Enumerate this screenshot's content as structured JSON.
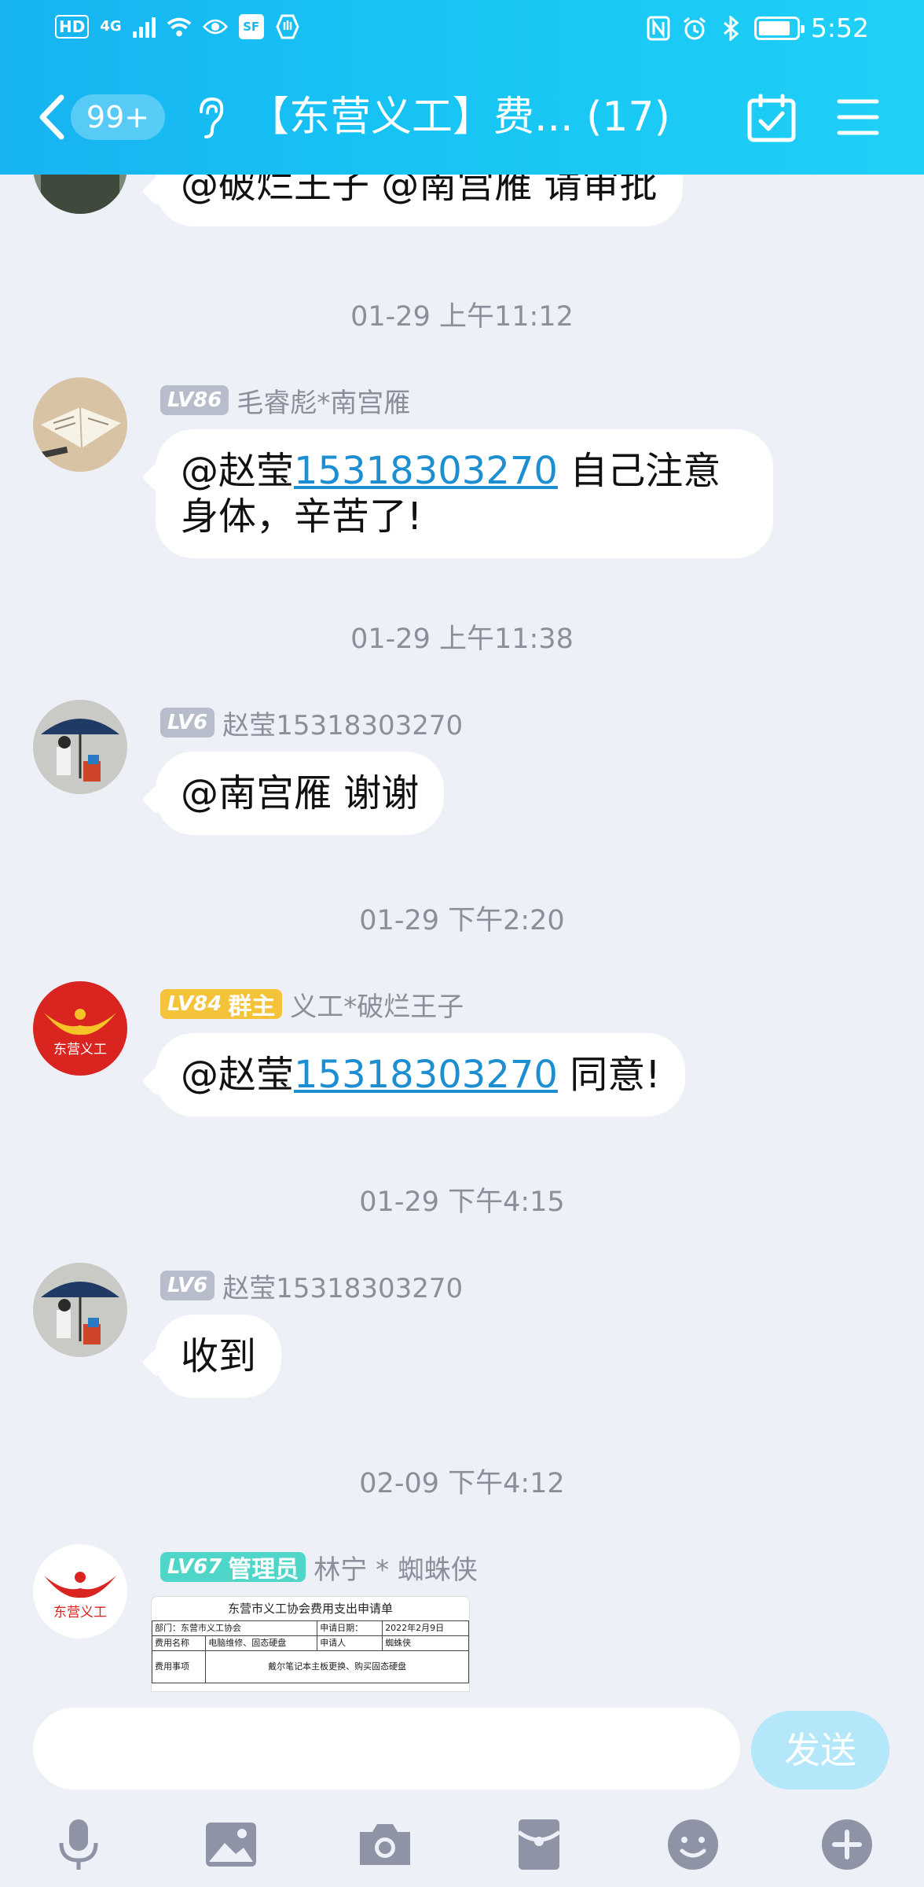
{
  "status_bar": {
    "hd": "HD",
    "network": "4G",
    "time": "5:52",
    "sf_label": "SF",
    "battery_level": 0.85
  },
  "nav": {
    "unread_badge": "99+",
    "title": "【东营义工】费... (17)"
  },
  "messages": {
    "m0": {
      "text": "@破烂王子 @南宫雁 请审批"
    },
    "t1": "01-29 上午11:12",
    "m1": {
      "level": "LV86",
      "sender": "毛睿彪*南宫雁",
      "mention": "@赵莹",
      "link": "15318303270",
      "text_line1": " 自己注意",
      "text_line2": "身体，辛苦了!"
    },
    "t2": "01-29 上午11:38",
    "m2": {
      "level": "LV6",
      "sender": "赵莹15318303270",
      "text": "@南宫雁 谢谢"
    },
    "t3": "01-29 下午2:20",
    "m3": {
      "level": "LV84",
      "role": "群主",
      "sender": "义工*破烂王子",
      "mention": "@赵莹",
      "link": "15318303270",
      "text": " 同意!"
    },
    "t4": "01-29 下午4:15",
    "m4": {
      "level": "LV6",
      "sender": "赵莹15318303270",
      "text": "收到"
    },
    "t5": "02-09 下午4:12",
    "m5": {
      "level": "LV67",
      "role": "管理员",
      "sender": "林宁 * 蜘蛛侠",
      "doc": {
        "title": "东营市义工协会费用支出申请单",
        "dept": "部门：东营市义工协会",
        "date_label": "申请日期：",
        "date": "2022年2月9日",
        "fee_name_label": "费用名称",
        "fee_name": "电脑维修、固态硬盘",
        "applicant_label": "申请人",
        "applicant": "蜘蛛侠",
        "matter_label": "费用事项",
        "matter": "戴尔笔记本主板更换、购买固态硬盘"
      }
    },
    "avatar_logo_text": "东营义工"
  },
  "composer": {
    "input_value": "",
    "send_label": "发送"
  },
  "toolbar": {
    "icons": [
      "microphone-icon",
      "image-icon",
      "camera-icon",
      "red-packet-icon",
      "emoji-icon",
      "plus-icon"
    ]
  },
  "colors": {
    "header_gradient_start": "#17b3f2",
    "header_gradient_end": "#1fd0f6",
    "link": "#1d8fd0",
    "owner_badge": "#f5c33a",
    "admin_badge": "#4fd6c8",
    "send_button": "#b4e7f9",
    "background": "#eef0f7"
  }
}
